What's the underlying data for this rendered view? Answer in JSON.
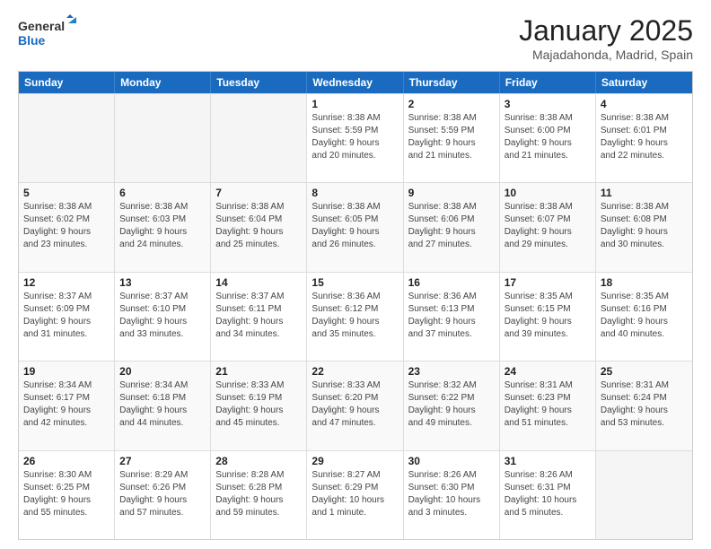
{
  "header": {
    "logo_text_1": "General",
    "logo_text_2": "Blue",
    "month": "January 2025",
    "location": "Majadahonda, Madrid, Spain"
  },
  "weekdays": [
    "Sunday",
    "Monday",
    "Tuesday",
    "Wednesday",
    "Thursday",
    "Friday",
    "Saturday"
  ],
  "rows": [
    [
      {
        "day": "",
        "info": ""
      },
      {
        "day": "",
        "info": ""
      },
      {
        "day": "",
        "info": ""
      },
      {
        "day": "1",
        "info": "Sunrise: 8:38 AM\nSunset: 5:59 PM\nDaylight: 9 hours\nand 20 minutes."
      },
      {
        "day": "2",
        "info": "Sunrise: 8:38 AM\nSunset: 5:59 PM\nDaylight: 9 hours\nand 21 minutes."
      },
      {
        "day": "3",
        "info": "Sunrise: 8:38 AM\nSunset: 6:00 PM\nDaylight: 9 hours\nand 21 minutes."
      },
      {
        "day": "4",
        "info": "Sunrise: 8:38 AM\nSunset: 6:01 PM\nDaylight: 9 hours\nand 22 minutes."
      }
    ],
    [
      {
        "day": "5",
        "info": "Sunrise: 8:38 AM\nSunset: 6:02 PM\nDaylight: 9 hours\nand 23 minutes."
      },
      {
        "day": "6",
        "info": "Sunrise: 8:38 AM\nSunset: 6:03 PM\nDaylight: 9 hours\nand 24 minutes."
      },
      {
        "day": "7",
        "info": "Sunrise: 8:38 AM\nSunset: 6:04 PM\nDaylight: 9 hours\nand 25 minutes."
      },
      {
        "day": "8",
        "info": "Sunrise: 8:38 AM\nSunset: 6:05 PM\nDaylight: 9 hours\nand 26 minutes."
      },
      {
        "day": "9",
        "info": "Sunrise: 8:38 AM\nSunset: 6:06 PM\nDaylight: 9 hours\nand 27 minutes."
      },
      {
        "day": "10",
        "info": "Sunrise: 8:38 AM\nSunset: 6:07 PM\nDaylight: 9 hours\nand 29 minutes."
      },
      {
        "day": "11",
        "info": "Sunrise: 8:38 AM\nSunset: 6:08 PM\nDaylight: 9 hours\nand 30 minutes."
      }
    ],
    [
      {
        "day": "12",
        "info": "Sunrise: 8:37 AM\nSunset: 6:09 PM\nDaylight: 9 hours\nand 31 minutes."
      },
      {
        "day": "13",
        "info": "Sunrise: 8:37 AM\nSunset: 6:10 PM\nDaylight: 9 hours\nand 33 minutes."
      },
      {
        "day": "14",
        "info": "Sunrise: 8:37 AM\nSunset: 6:11 PM\nDaylight: 9 hours\nand 34 minutes."
      },
      {
        "day": "15",
        "info": "Sunrise: 8:36 AM\nSunset: 6:12 PM\nDaylight: 9 hours\nand 35 minutes."
      },
      {
        "day": "16",
        "info": "Sunrise: 8:36 AM\nSunset: 6:13 PM\nDaylight: 9 hours\nand 37 minutes."
      },
      {
        "day": "17",
        "info": "Sunrise: 8:35 AM\nSunset: 6:15 PM\nDaylight: 9 hours\nand 39 minutes."
      },
      {
        "day": "18",
        "info": "Sunrise: 8:35 AM\nSunset: 6:16 PM\nDaylight: 9 hours\nand 40 minutes."
      }
    ],
    [
      {
        "day": "19",
        "info": "Sunrise: 8:34 AM\nSunset: 6:17 PM\nDaylight: 9 hours\nand 42 minutes."
      },
      {
        "day": "20",
        "info": "Sunrise: 8:34 AM\nSunset: 6:18 PM\nDaylight: 9 hours\nand 44 minutes."
      },
      {
        "day": "21",
        "info": "Sunrise: 8:33 AM\nSunset: 6:19 PM\nDaylight: 9 hours\nand 45 minutes."
      },
      {
        "day": "22",
        "info": "Sunrise: 8:33 AM\nSunset: 6:20 PM\nDaylight: 9 hours\nand 47 minutes."
      },
      {
        "day": "23",
        "info": "Sunrise: 8:32 AM\nSunset: 6:22 PM\nDaylight: 9 hours\nand 49 minutes."
      },
      {
        "day": "24",
        "info": "Sunrise: 8:31 AM\nSunset: 6:23 PM\nDaylight: 9 hours\nand 51 minutes."
      },
      {
        "day": "25",
        "info": "Sunrise: 8:31 AM\nSunset: 6:24 PM\nDaylight: 9 hours\nand 53 minutes."
      }
    ],
    [
      {
        "day": "26",
        "info": "Sunrise: 8:30 AM\nSunset: 6:25 PM\nDaylight: 9 hours\nand 55 minutes."
      },
      {
        "day": "27",
        "info": "Sunrise: 8:29 AM\nSunset: 6:26 PM\nDaylight: 9 hours\nand 57 minutes."
      },
      {
        "day": "28",
        "info": "Sunrise: 8:28 AM\nSunset: 6:28 PM\nDaylight: 9 hours\nand 59 minutes."
      },
      {
        "day": "29",
        "info": "Sunrise: 8:27 AM\nSunset: 6:29 PM\nDaylight: 10 hours\nand 1 minute."
      },
      {
        "day": "30",
        "info": "Sunrise: 8:26 AM\nSunset: 6:30 PM\nDaylight: 10 hours\nand 3 minutes."
      },
      {
        "day": "31",
        "info": "Sunrise: 8:26 AM\nSunset: 6:31 PM\nDaylight: 10 hours\nand 5 minutes."
      },
      {
        "day": "",
        "info": ""
      }
    ]
  ]
}
